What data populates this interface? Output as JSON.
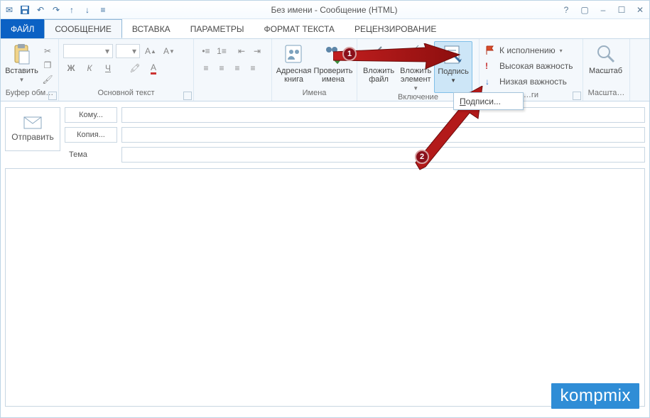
{
  "title": "Без имени - Сообщение (HTML)",
  "qat": {
    "mail": "✉",
    "save": "💾",
    "undo": "↶",
    "redo": "↷",
    "up": "▲",
    "down": "▼"
  },
  "winctl": {
    "help": "?",
    "rib": "▢",
    "min": "–",
    "max": "☐",
    "close": "✕"
  },
  "tabs": {
    "file": "ФАЙЛ",
    "message": "СООБЩЕНИЕ",
    "insert": "ВСТАВКА",
    "options": "ПАРАМЕТРЫ",
    "format": "ФОРМАТ ТЕКСТА",
    "review": "РЕЦЕНЗИРОВАНИЕ"
  },
  "ribbon": {
    "paste": "Вставить",
    "clip_group": "Буфер обм…",
    "font_group": "Основной текст",
    "b": "Ж",
    "i": "К",
    "u": "Ч",
    "addrbook": "Адресная\nкнига",
    "checknames": "Проверить\nимена",
    "names_group": "Имена",
    "attachfile": "Вложить\nфайл",
    "attachitem": "Вложить\nэлемент",
    "signature": "Подпись",
    "include_group": "Включение",
    "follow": "К исполнению",
    "himp": "Высокая важность",
    "loimp": "Низкая важность",
    "tags_group": "…ги",
    "zoom": "Масштаб",
    "zoom_group": "Масшта…"
  },
  "dropdown": {
    "label": "Подписи...",
    "u": "П",
    "rest": "одписи..."
  },
  "send": "Отправить",
  "fields": {
    "to": "Кому...",
    "cc": "Копия...",
    "subject": "Тема"
  },
  "callouts": {
    "one": "1",
    "two": "2"
  },
  "watermark": "kompmix",
  "icons": {
    "dropdown": "▾"
  }
}
